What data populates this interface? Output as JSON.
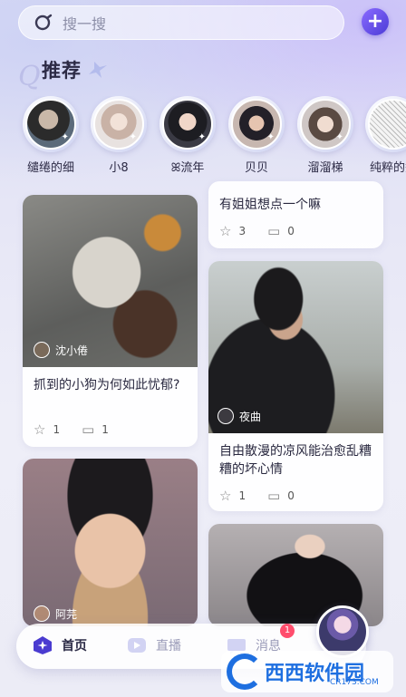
{
  "search": {
    "placeholder": "搜一搜"
  },
  "add_button": {
    "label": "+"
  },
  "section": {
    "title": "推荐"
  },
  "stories": [
    {
      "name": "缱绻的细"
    },
    {
      "name": "小8"
    },
    {
      "name": "ꕤ流年"
    },
    {
      "name": "贝贝"
    },
    {
      "name": "溜溜梯"
    },
    {
      "name": "纯粹的秃"
    }
  ],
  "feed": {
    "left": [
      {
        "author": "沈小倦",
        "text": "抓到的小狗为何如此忧郁?",
        "likes": "1",
        "comments": "1"
      },
      {
        "author": "阿芫"
      }
    ],
    "right": [
      {
        "text": "有姐姐想点一个嘛",
        "likes": "3",
        "comments": "0"
      },
      {
        "author": "夜曲",
        "text": "自由散漫的凉风能治愈乱糟糟的坏心情",
        "likes": "1",
        "comments": "0"
      },
      {
        "author": ""
      }
    ]
  },
  "nav": {
    "home": "首页",
    "live": "直播",
    "messages": "消息",
    "badge": "1"
  },
  "watermark": {
    "main": "西西软件园",
    "sub": "CR173.COM"
  },
  "colors": {
    "accent": "#5b46e0",
    "badge": "#ff4d6d"
  }
}
